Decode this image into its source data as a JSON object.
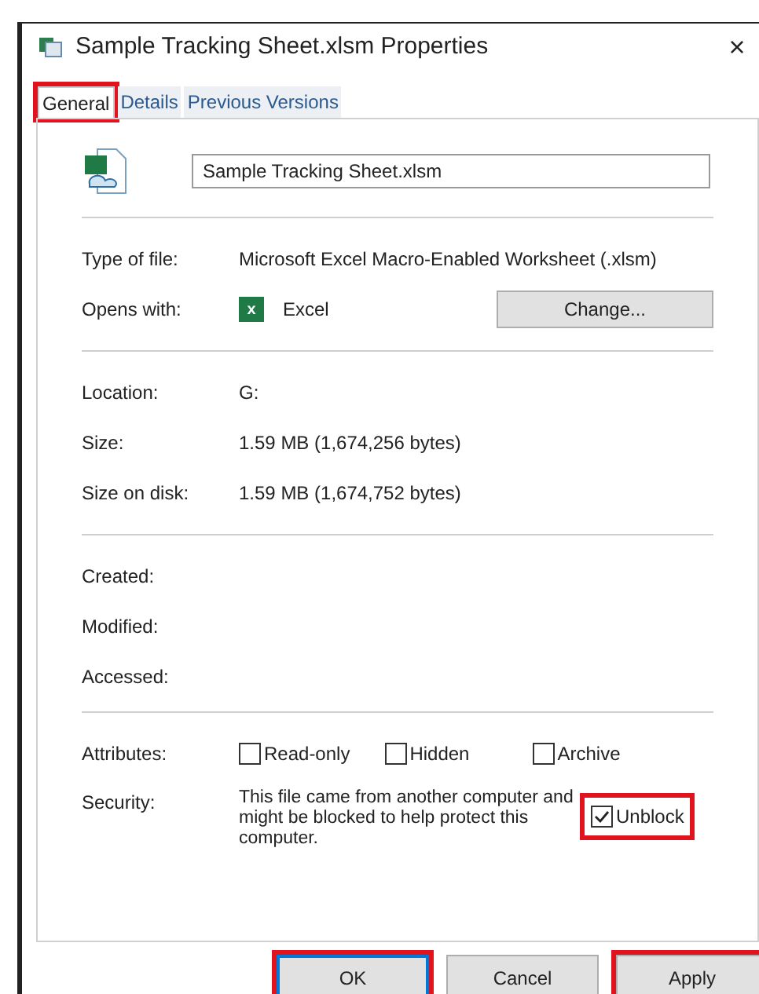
{
  "window": {
    "title": "Sample Tracking Sheet.xlsm Properties",
    "close": "×"
  },
  "tabs": [
    {
      "label": "General",
      "selected": true,
      "highlighted": true
    },
    {
      "label": "Details",
      "selected": false,
      "highlighted": false
    },
    {
      "label": "Previous Versions",
      "selected": false,
      "highlighted": false
    }
  ],
  "file_name": {
    "value": "Sample Tracking Sheet.xlsm"
  },
  "groups": [
    [
      {
        "label": "Type of file:",
        "value": "Microsoft Excel Macro-Enabled Worksheet (.xlsm)"
      },
      {
        "label": "Opens with:",
        "value": "Excel",
        "app_icon": "x",
        "button": "Change..."
      }
    ],
    [
      {
        "label": "Location:",
        "value": "G:"
      },
      {
        "label": "Size:",
        "value": "1.59 MB (1,674,256 bytes)"
      },
      {
        "label": "Size on disk:",
        "value": "1.59 MB (1,674,752 bytes)"
      }
    ],
    [
      {
        "label": "Created:"
      },
      {
        "label": "Modified:"
      },
      {
        "label": "Accessed:"
      }
    ]
  ],
  "attributes": {
    "label": "Attributes:",
    "options": [
      {
        "label": "Read-only",
        "checked": false
      },
      {
        "label": "Hidden",
        "checked": false
      },
      {
        "label": "Archive",
        "checked": false
      }
    ]
  },
  "security": {
    "label": "Security:",
    "text": "This file came from another computer and might be blocked to help protect this computer.",
    "unblock": {
      "label": "Unblock",
      "checked": true,
      "highlighted": true
    }
  },
  "buttons": [
    {
      "label": "OK",
      "default": true,
      "highlighted": true
    },
    {
      "label": "Cancel",
      "default": false,
      "highlighted": false
    },
    {
      "label": "Apply",
      "default": false,
      "highlighted": true
    }
  ]
}
